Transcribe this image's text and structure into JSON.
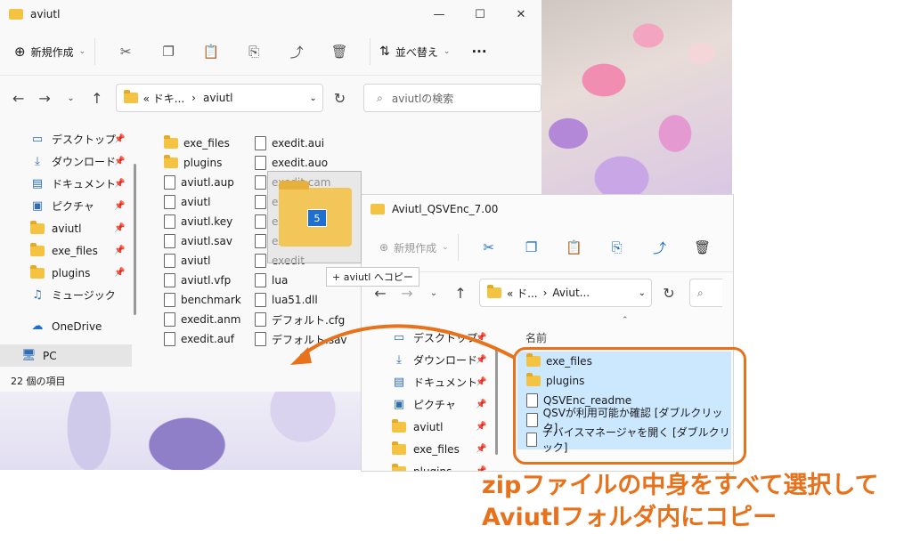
{
  "window1": {
    "title": "aviutl",
    "controls": [
      "—",
      "☐",
      "✕"
    ],
    "toolbar": {
      "new_label": "新規作成",
      "sort_label": "並べ替え",
      "more": "···"
    },
    "address": {
      "path_prefix": "« ドキ...",
      "path_sep": "›",
      "path_current": "aviutl"
    },
    "search": {
      "placeholder": "aviutlの検索"
    },
    "sidebar": [
      {
        "label": "デスクトップ",
        "icon": "desktop-icon"
      },
      {
        "label": "ダウンロード",
        "icon": "download-icon"
      },
      {
        "label": "ドキュメント",
        "icon": "document-icon"
      },
      {
        "label": "ピクチャ",
        "icon": "picture-icon"
      },
      {
        "label": "aviutl",
        "icon": "folder-icon"
      },
      {
        "label": "exe_files",
        "icon": "folder-icon"
      },
      {
        "label": "plugins",
        "icon": "folder-icon"
      },
      {
        "label": "ミュージック",
        "icon": "music-icon"
      },
      {
        "label": "OneDrive",
        "icon": "cloud-icon"
      },
      {
        "label": "PC",
        "icon": "pc-icon"
      }
    ],
    "files_col1": [
      "exe_files",
      "plugins",
      "aviutl.aup",
      "aviutl",
      "aviutl.key",
      "aviutl.sav",
      "aviutl",
      "aviutl.vfp",
      "benchmark",
      "exedit.anm",
      "exedit.auf"
    ],
    "files_col2": [
      "exedit.aui",
      "exedit.auo",
      "exedit.cam",
      "exedit",
      "exedit.ini",
      "exedit.scn",
      "exedit",
      "lua",
      "lua51.dll",
      "デフォルト.cfg",
      "デフォルト.sav"
    ],
    "status": "22 個の項目"
  },
  "drag": {
    "count": "5",
    "tooltip": "+ aviutl へコピー"
  },
  "window2": {
    "title": "Aviutl_QSVEnc_7.00",
    "toolbar": {
      "new_label": "新規作成"
    },
    "address": {
      "path_prefix": "« ド...",
      "path_sep": "›",
      "path_current": "Aviut..."
    },
    "column_header": "名前",
    "sidebar": [
      {
        "label": "デスクトップ"
      },
      {
        "label": "ダウンロード"
      },
      {
        "label": "ドキュメント"
      },
      {
        "label": "ピクチャ"
      },
      {
        "label": "aviutl"
      },
      {
        "label": "exe_files"
      },
      {
        "label": "plugins"
      }
    ],
    "files": [
      {
        "label": "exe_files",
        "type": "folder"
      },
      {
        "label": "plugins",
        "type": "folder"
      },
      {
        "label": "QSVEnc_readme",
        "type": "file"
      },
      {
        "label": "QSVが利用可能か確認 [ダブルクリック]",
        "type": "script"
      },
      {
        "label": "デバイスマネージャを開く [ダブルクリック]",
        "type": "script"
      }
    ]
  },
  "callout": {
    "line1": "zipファイルの中身をすべて選択して",
    "line2": "Aviutlフォルダ内にコピー"
  },
  "colors": {
    "accent_orange": "#e8721c",
    "selection": "#cce8ff",
    "folder": "#f5c342"
  }
}
